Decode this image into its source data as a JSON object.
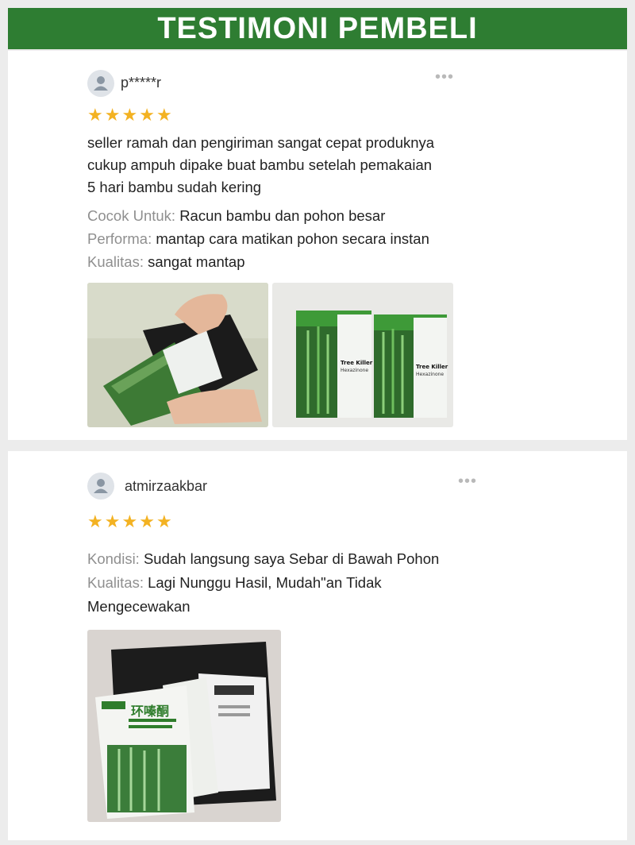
{
  "banner": {
    "title": "TESTIMONI PEMBELI"
  },
  "reviews": [
    {
      "username": "p*****r",
      "rating": 5,
      "text_lines": [
        "seller ramah dan pengiriman sangat cepat produknya",
        "cukup ampuh dipake buat bambu setelah pemakaian",
        "5 hari bambu sudah kering"
      ],
      "attributes": [
        {
          "label": "Cocok Untuk:",
          "value": "Racun bambu dan pohon besar"
        },
        {
          "label": "Performa:",
          "value": "mantap cara matikan pohon secara instan"
        },
        {
          "label": "Kualitas:",
          "value": "sangat mantap"
        }
      ],
      "photos": [
        "hands opening product package",
        "two Tree Killer packets"
      ],
      "packet_label": "Tree Killer",
      "packet_sublabel": "Hexazinone"
    },
    {
      "username": "atmirzaakbar",
      "rating": 5,
      "attributes": [
        {
          "label": "Kondisi:",
          "value": "Sudah langsung saya Sebar di Bawah Pohon"
        },
        {
          "label": "Kualitas:",
          "value": "Lagi Nunggu Hasil, Mudah\"an Tidak"
        }
      ],
      "attr_continuation": "Mengecewakan",
      "photos": [
        "product packets on black shipping bag"
      ],
      "packet_chinese": "环嗪酮"
    }
  ],
  "colors": {
    "banner": "#2e7d32",
    "star": "#f3b222",
    "label": "#8f8f8f"
  }
}
